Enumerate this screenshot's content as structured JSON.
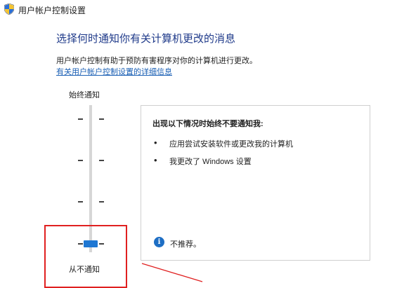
{
  "window": {
    "title": "用户帐户控制设置",
    "icon": "shield-icon"
  },
  "main": {
    "heading": "选择何时通知你有关计算机更改的消息",
    "description": "用户帐户控制有助于预防有害程序对你的计算机进行更改。",
    "link_text": "有关用户帐户控制设置的详细信息"
  },
  "slider": {
    "top_label": "始终通知",
    "bottom_label": "从不通知",
    "levels": 4,
    "selected_level": 1,
    "thumb_color": "#1e77d3"
  },
  "info_panel": {
    "heading": "出现以下情况时始终不要通知我:",
    "bullets": [
      "应用尝试安装软件或更改我的计算机",
      "我更改了 Windows 设置"
    ],
    "note_icon": "info-icon",
    "note": "不推荐。"
  },
  "annotation": {
    "highlight_color": "#e02020"
  }
}
